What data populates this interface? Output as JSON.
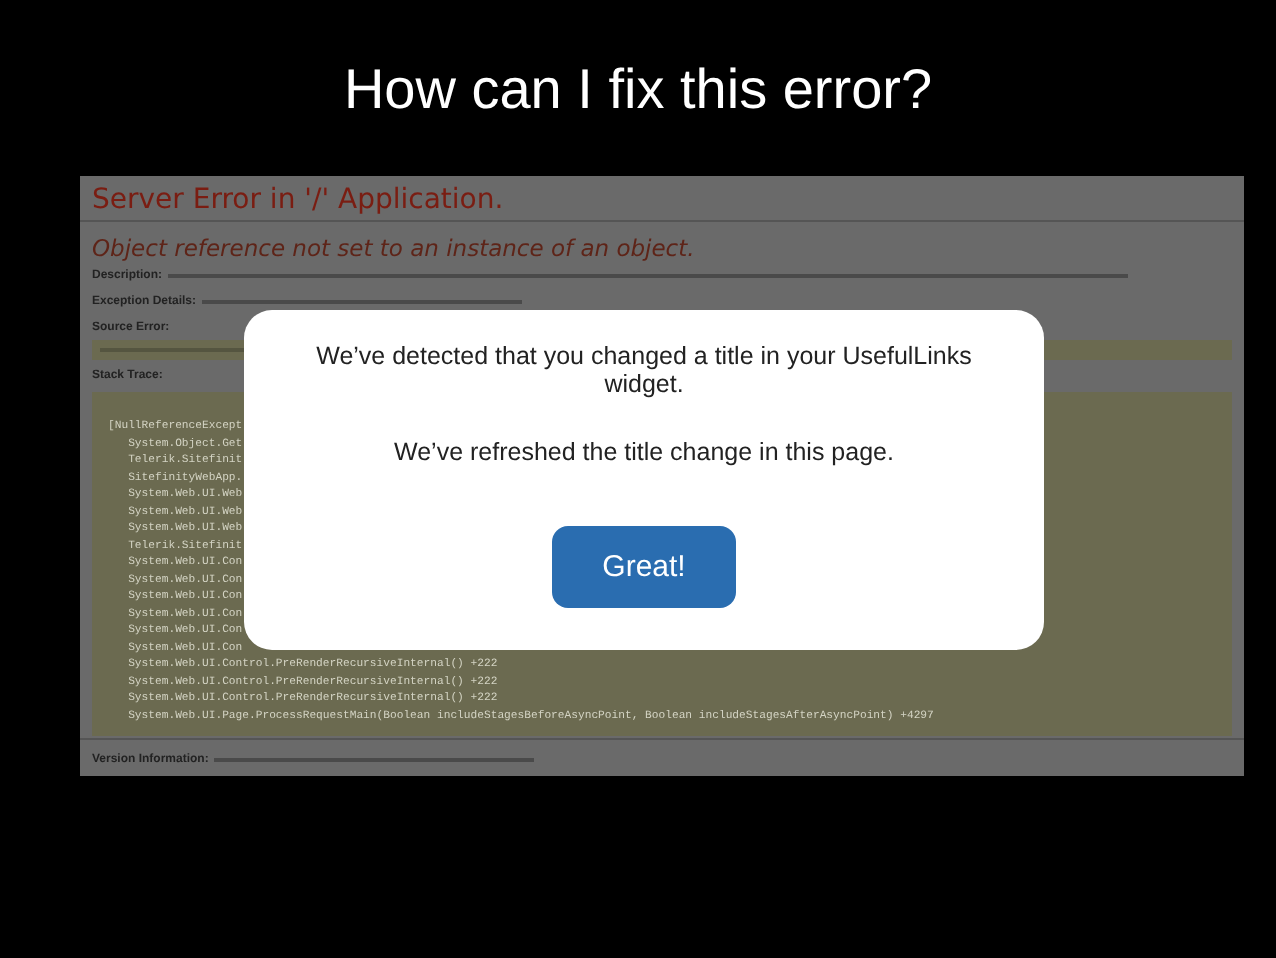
{
  "slide_title": "How can I fix this error?",
  "error_page": {
    "heading": "Server Error in '/' Application.",
    "message": "Object reference not set to an instance of an object.",
    "description_label": "Description:",
    "exception_label": "Exception Details:",
    "source_label": "Source Error:",
    "stack_label": "Stack Trace:",
    "stack_lines": [
      "[NullReferenceExcept",
      "   System.Object.Get",
      "   Telerik.Sitefinit",
      "   SitefinityWebApp.",
      "   System.Web.UI.Web",
      "   System.Web.UI.Web",
      "   System.Web.UI.Web",
      "   Telerik.Sitefinit",
      "   System.Web.UI.Con",
      "   System.Web.UI.Con",
      "   System.Web.UI.Con",
      "   System.Web.UI.Con",
      "   System.Web.UI.Con",
      "   System.Web.UI.Con",
      "   System.Web.UI.Control.PreRenderRecursiveInternal() +222",
      "   System.Web.UI.Control.PreRenderRecursiveInternal() +222",
      "   System.Web.UI.Control.PreRenderRecursiveInternal() +222",
      "   System.Web.UI.Page.ProcessRequestMain(Boolean includeStagesBeforeAsyncPoint, Boolean includeStagesAfterAsyncPoint) +4297"
    ],
    "version_label": "Version Information:"
  },
  "dialog": {
    "messages": [
      "We’ve detected that you changed a title in your UsefulLinks widget.",
      "We’ve refreshed the title change in this page."
    ],
    "button": "Great!"
  }
}
